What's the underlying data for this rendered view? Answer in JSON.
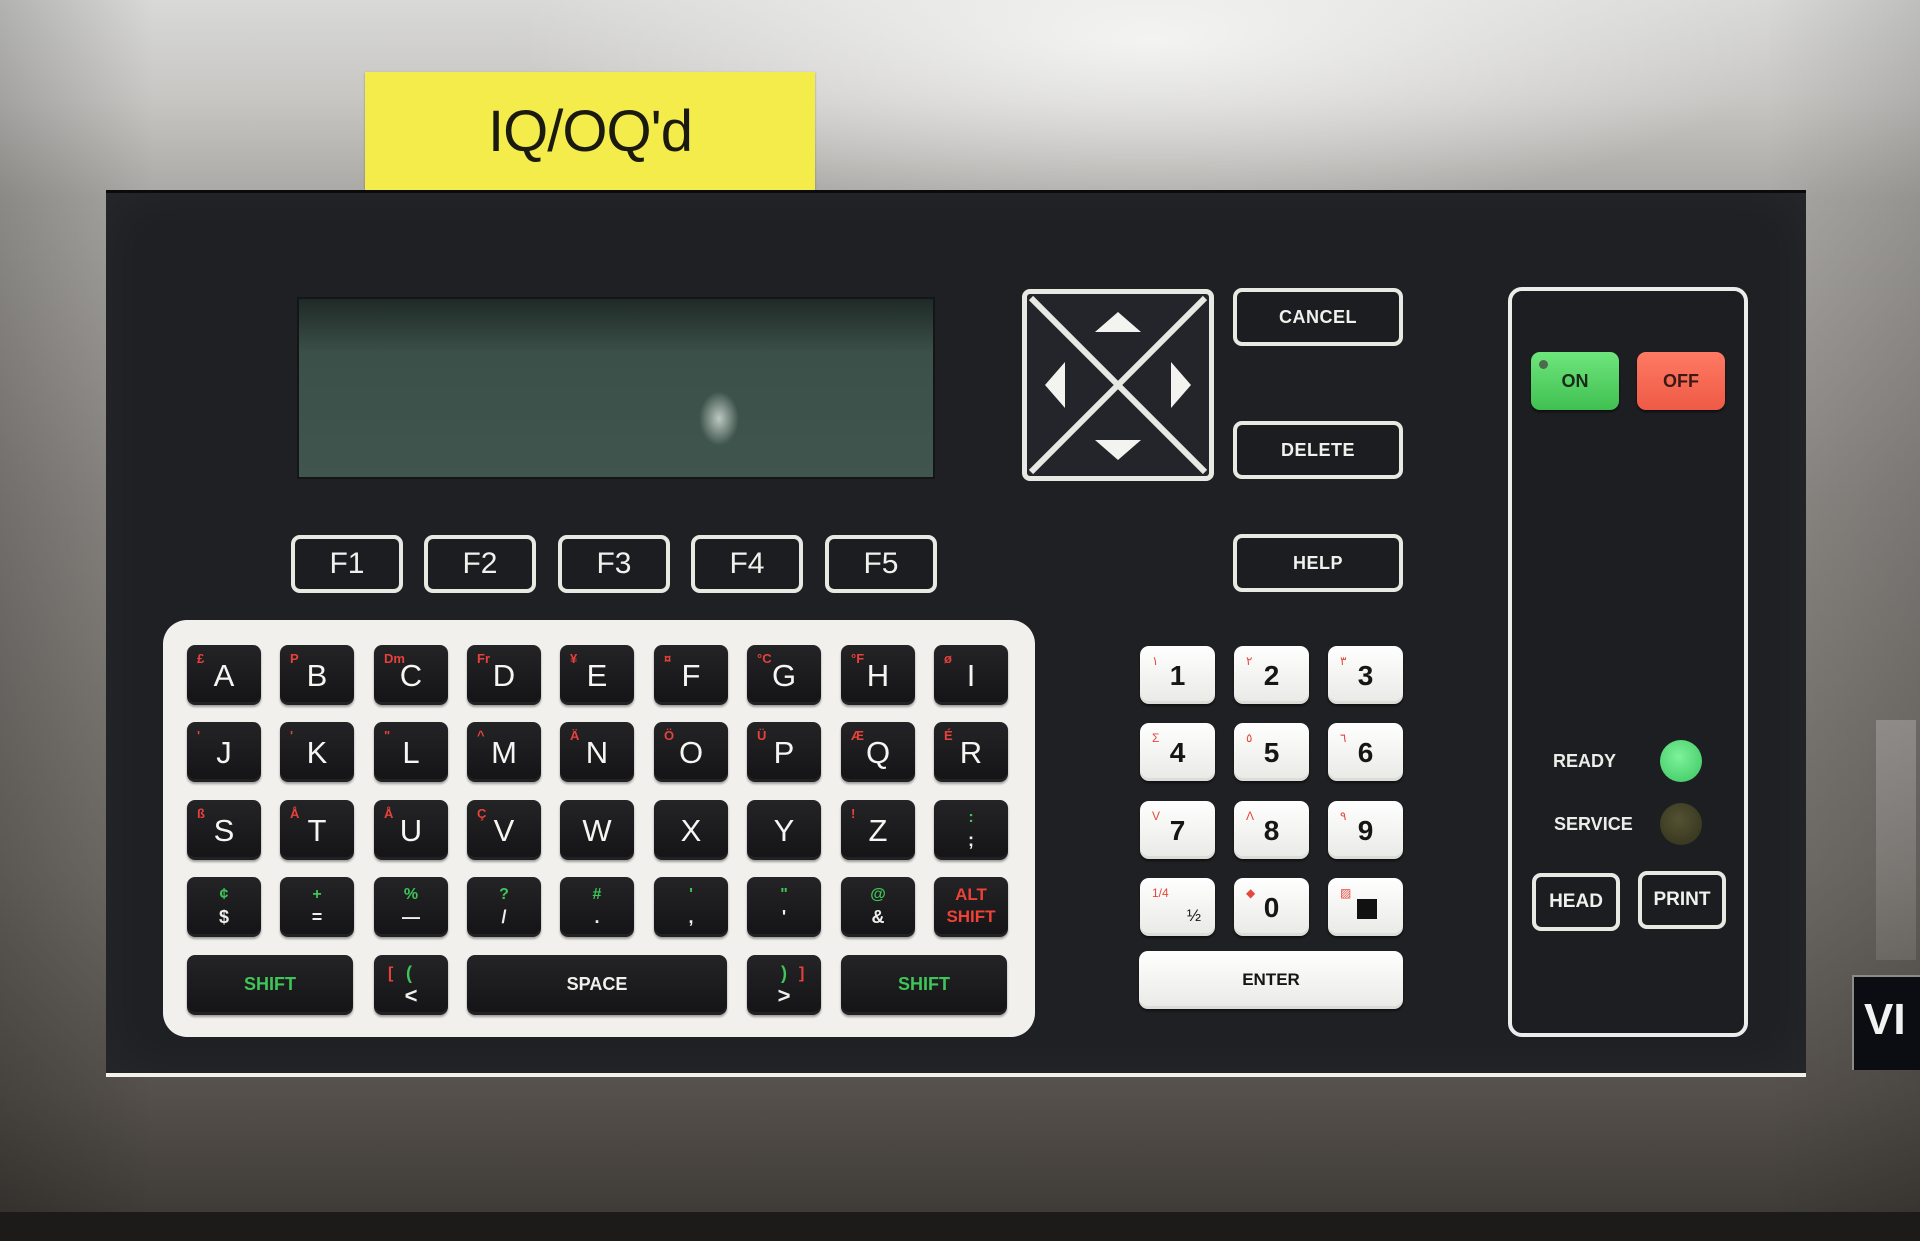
{
  "label_tag": {
    "text": "IQ/OQ'd"
  },
  "display": {
    "text": ""
  },
  "function_keys": [
    "F1",
    "F2",
    "F3",
    "F4",
    "F5"
  ],
  "commands": {
    "cancel": "CANCEL",
    "delete": "DELETE",
    "help": "HELP"
  },
  "arrows": {
    "up": "up-arrow",
    "down": "down-arrow",
    "left": "left-arrow",
    "right": "right-arrow"
  },
  "alpha_rows": [
    [
      {
        "main": "A",
        "alt": "£"
      },
      {
        "main": "B",
        "alt": "P"
      },
      {
        "main": "C",
        "alt": "Dm"
      },
      {
        "main": "D",
        "alt": "Fr"
      },
      {
        "main": "E",
        "alt": "¥"
      },
      {
        "main": "F",
        "alt": "¤"
      },
      {
        "main": "G",
        "alt": "°C"
      },
      {
        "main": "H",
        "alt": "°F"
      },
      {
        "main": "I",
        "alt": "ø"
      }
    ],
    [
      {
        "main": "J",
        "alt": "'"
      },
      {
        "main": "K",
        "alt": "'"
      },
      {
        "main": "L",
        "alt": "\""
      },
      {
        "main": "M",
        "alt": "^"
      },
      {
        "main": "N",
        "alt": "Ä"
      },
      {
        "main": "O",
        "alt": "Ö"
      },
      {
        "main": "P",
        "alt": "Ü"
      },
      {
        "main": "Q",
        "alt": "Æ"
      },
      {
        "main": "R",
        "alt": "É"
      }
    ],
    [
      {
        "main": "S",
        "alt": "ß"
      },
      {
        "main": "T",
        "alt": "Å"
      },
      {
        "main": "U",
        "alt": "Å"
      },
      {
        "main": "V",
        "alt": "Ç"
      },
      {
        "main": "W",
        "alt": ""
      },
      {
        "main": "X",
        "alt": ""
      },
      {
        "main": "Y",
        "alt": ""
      },
      {
        "main": "Z",
        "alt": "!"
      }
    ]
  ],
  "semicolon_key": {
    "top": ":",
    "bottom": ";"
  },
  "symbol_row": [
    {
      "top": "¢",
      "bottom": "$"
    },
    {
      "top": "+",
      "bottom": "="
    },
    {
      "top": "%",
      "bottom": "—"
    },
    {
      "top": "?",
      "bottom": "/"
    },
    {
      "top": "#",
      "bottom": "."
    },
    {
      "top": "'",
      "bottom": ","
    },
    {
      "top": "\"",
      "bottom": "'"
    },
    {
      "top": "@",
      "bottom": "&"
    }
  ],
  "alt_shift": {
    "line1": "ALT",
    "line2": "SHIFT"
  },
  "bottom_row": {
    "shift_left": "SHIFT",
    "less_than": {
      "red": "[",
      "green": "(",
      "white": "<"
    },
    "space": "SPACE",
    "greater_than": {
      "green": ")",
      "red": "]",
      "white": ">"
    },
    "shift_right": "SHIFT"
  },
  "numpad": [
    {
      "main": "1",
      "alt": "١"
    },
    {
      "main": "2",
      "alt": "٢"
    },
    {
      "main": "3",
      "alt": "٣"
    },
    {
      "main": "4",
      "alt": "Σ"
    },
    {
      "main": "5",
      "alt": "٥"
    },
    {
      "main": "6",
      "alt": "٦"
    },
    {
      "main": "7",
      "alt": "V"
    },
    {
      "main": "8",
      "alt": "Λ"
    },
    {
      "main": "9",
      "alt": "٩"
    },
    {
      "main": "",
      "alt": "1/4",
      "frac": "½"
    },
    {
      "main": "0",
      "alt": "◆"
    },
    {
      "main": "",
      "alt": "▨",
      "square": true
    }
  ],
  "enter": "ENTER",
  "power": {
    "on": "ON",
    "off": "OFF"
  },
  "status": {
    "ready": {
      "label": "READY",
      "state": "on",
      "color": "#5ee07f"
    },
    "service": {
      "label": "SERVICE",
      "state": "off",
      "color": "#45432a"
    }
  },
  "head": "HEAD",
  "print": "PRINT",
  "side_plate": {
    "text": "VI"
  }
}
